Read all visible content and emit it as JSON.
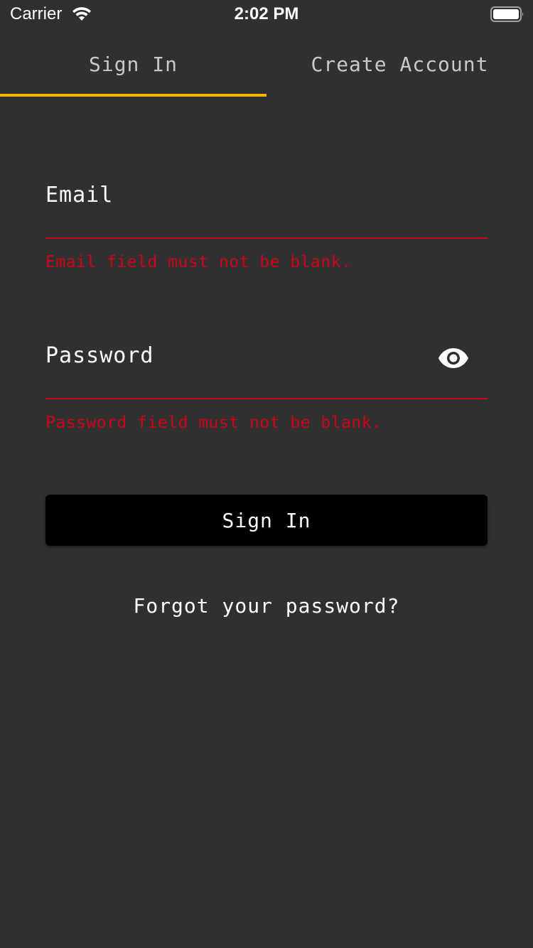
{
  "status_bar": {
    "carrier": "Carrier",
    "time": "2:02 PM",
    "wifi_icon": "wifi-icon",
    "battery_icon": "battery-icon"
  },
  "tabs": [
    {
      "label": "Sign In",
      "active": true
    },
    {
      "label": "Create Account",
      "active": false
    }
  ],
  "form": {
    "email": {
      "placeholder": "Email",
      "value": "",
      "error": "Email field must not be blank."
    },
    "password": {
      "placeholder": "Password",
      "value": "",
      "error": "Password field must not be blank.",
      "toggle_icon": "eye-icon"
    },
    "submit_label": "Sign In",
    "forgot_label": "Forgot your password?"
  },
  "colors": {
    "background": "#303030",
    "accent": "#f5b301",
    "error": "#d0021b",
    "button": "#000000"
  }
}
